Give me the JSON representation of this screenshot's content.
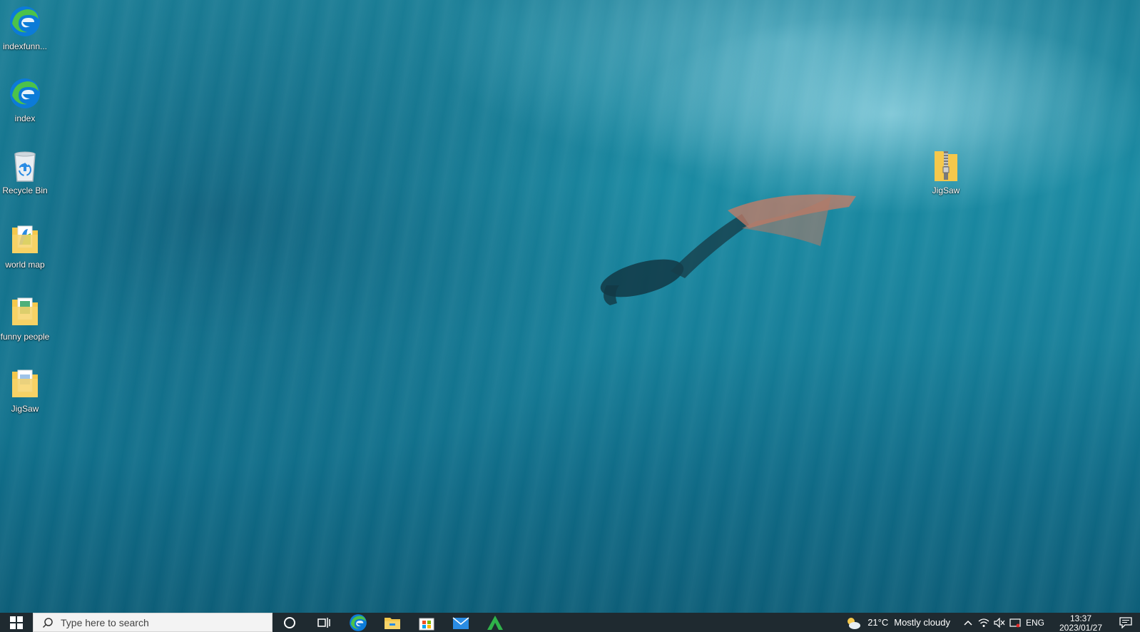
{
  "desktop": {
    "icons": [
      {
        "label": "indexfunn...",
        "icon": "edge-icon"
      },
      {
        "label": "index",
        "icon": "edge-icon"
      },
      {
        "label": "Recycle Bin",
        "icon": "recycle-bin-icon"
      },
      {
        "label": "world map",
        "icon": "folder-icon"
      },
      {
        "label": "funny people",
        "icon": "folder-icon"
      },
      {
        "label": "JigSaw",
        "icon": "folder-icon"
      },
      {
        "label": "JigSaw",
        "icon": "zip-folder-icon"
      }
    ]
  },
  "taskbar": {
    "search_placeholder": "Type here to search",
    "pinned": [
      "cortana-icon",
      "task-view-icon",
      "edge-icon",
      "file-explorer-icon",
      "microsoft-store-icon",
      "mail-icon",
      "green-a-app-icon"
    ],
    "weather": {
      "temp": "21°C",
      "condition": "Mostly cloudy"
    },
    "language": "ENG",
    "time": "13:37",
    "date": "2023/01/27"
  },
  "colors": {
    "taskbar_bg": "#1f2a30",
    "edge_blue": "#0c7bd8",
    "edge_green": "#4cc24a",
    "folder_yellow": "#f5c84c",
    "mail_blue": "#2a8ce4",
    "store_red": "#f25022"
  }
}
